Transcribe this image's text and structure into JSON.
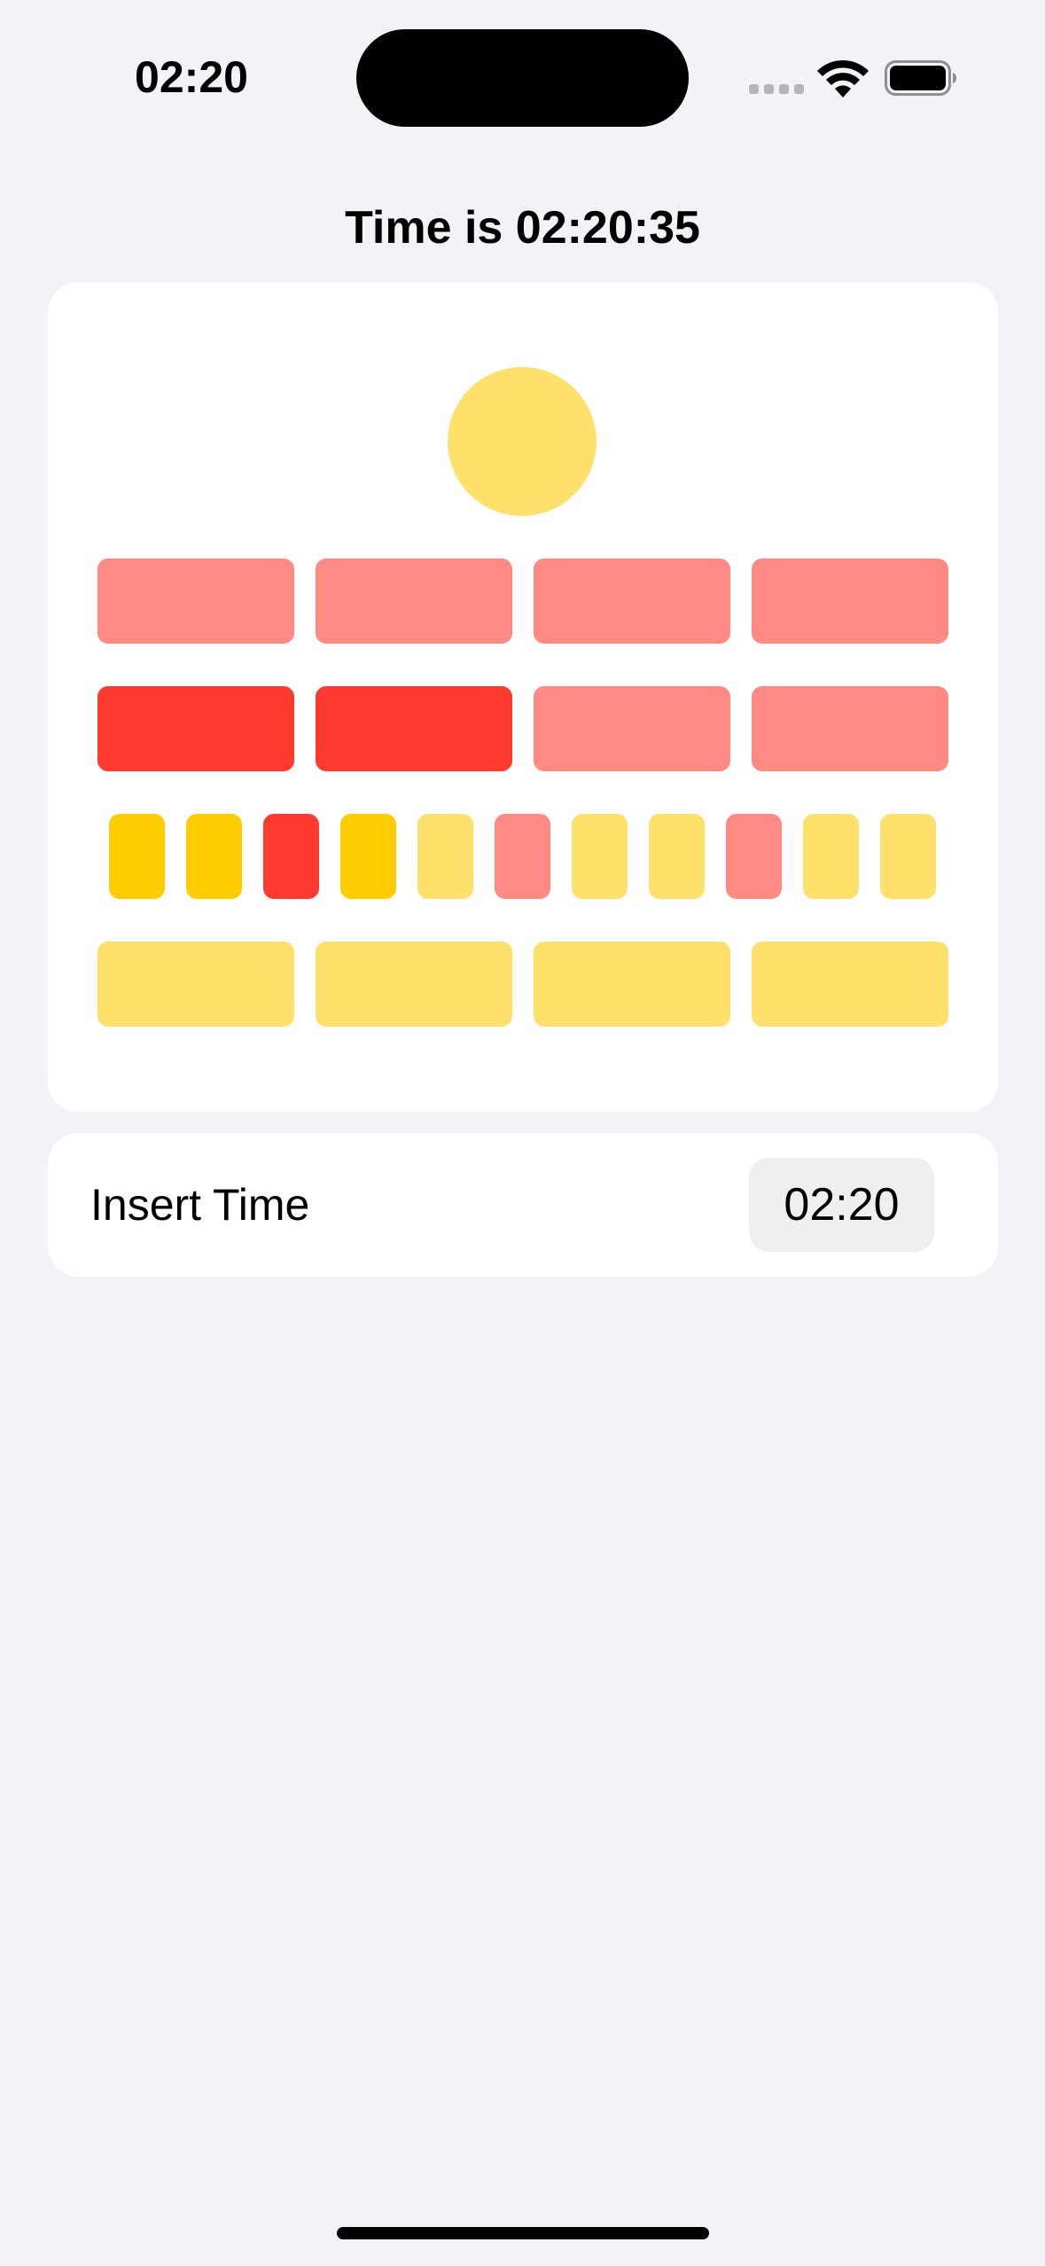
{
  "status_bar": {
    "time": "02:20",
    "icons": [
      "cellular-signal-icon",
      "wifi-icon",
      "battery-icon"
    ]
  },
  "title": "Time is 02:20:35",
  "clock": {
    "seconds_lamp": {
      "state": "on",
      "color": "#ffe06a"
    },
    "rows": [
      {
        "name": "five-hours",
        "lamps": [
          {
            "state": "off",
            "color": "#ff8a84"
          },
          {
            "state": "off",
            "color": "#ff8a84"
          },
          {
            "state": "off",
            "color": "#ff8a84"
          },
          {
            "state": "off",
            "color": "#ff8a84"
          }
        ]
      },
      {
        "name": "single-hours",
        "lamps": [
          {
            "state": "on",
            "color": "#ff3b30"
          },
          {
            "state": "on",
            "color": "#ff3b30"
          },
          {
            "state": "off",
            "color": "#ff8a84"
          },
          {
            "state": "off",
            "color": "#ff8a84"
          }
        ]
      },
      {
        "name": "five-minutes",
        "lamps": [
          {
            "state": "on",
            "color": "#ffcc00"
          },
          {
            "state": "on",
            "color": "#ffcc00"
          },
          {
            "state": "on",
            "color": "#ff3b30"
          },
          {
            "state": "on",
            "color": "#ffcc00"
          },
          {
            "state": "off",
            "color": "#ffe06a"
          },
          {
            "state": "off",
            "color": "#ff8a84"
          },
          {
            "state": "off",
            "color": "#ffe06a"
          },
          {
            "state": "off",
            "color": "#ffe06a"
          },
          {
            "state": "off",
            "color": "#ff8a84"
          },
          {
            "state": "off",
            "color": "#ffe06a"
          },
          {
            "state": "off",
            "color": "#ffe06a"
          }
        ]
      },
      {
        "name": "single-minutes",
        "lamps": [
          {
            "state": "off",
            "color": "#ffe06a"
          },
          {
            "state": "off",
            "color": "#ffe06a"
          },
          {
            "state": "off",
            "color": "#ffe06a"
          },
          {
            "state": "off",
            "color": "#ffe06a"
          }
        ]
      }
    ]
  },
  "insert_time": {
    "label": "Insert Time",
    "value": "02:20"
  }
}
